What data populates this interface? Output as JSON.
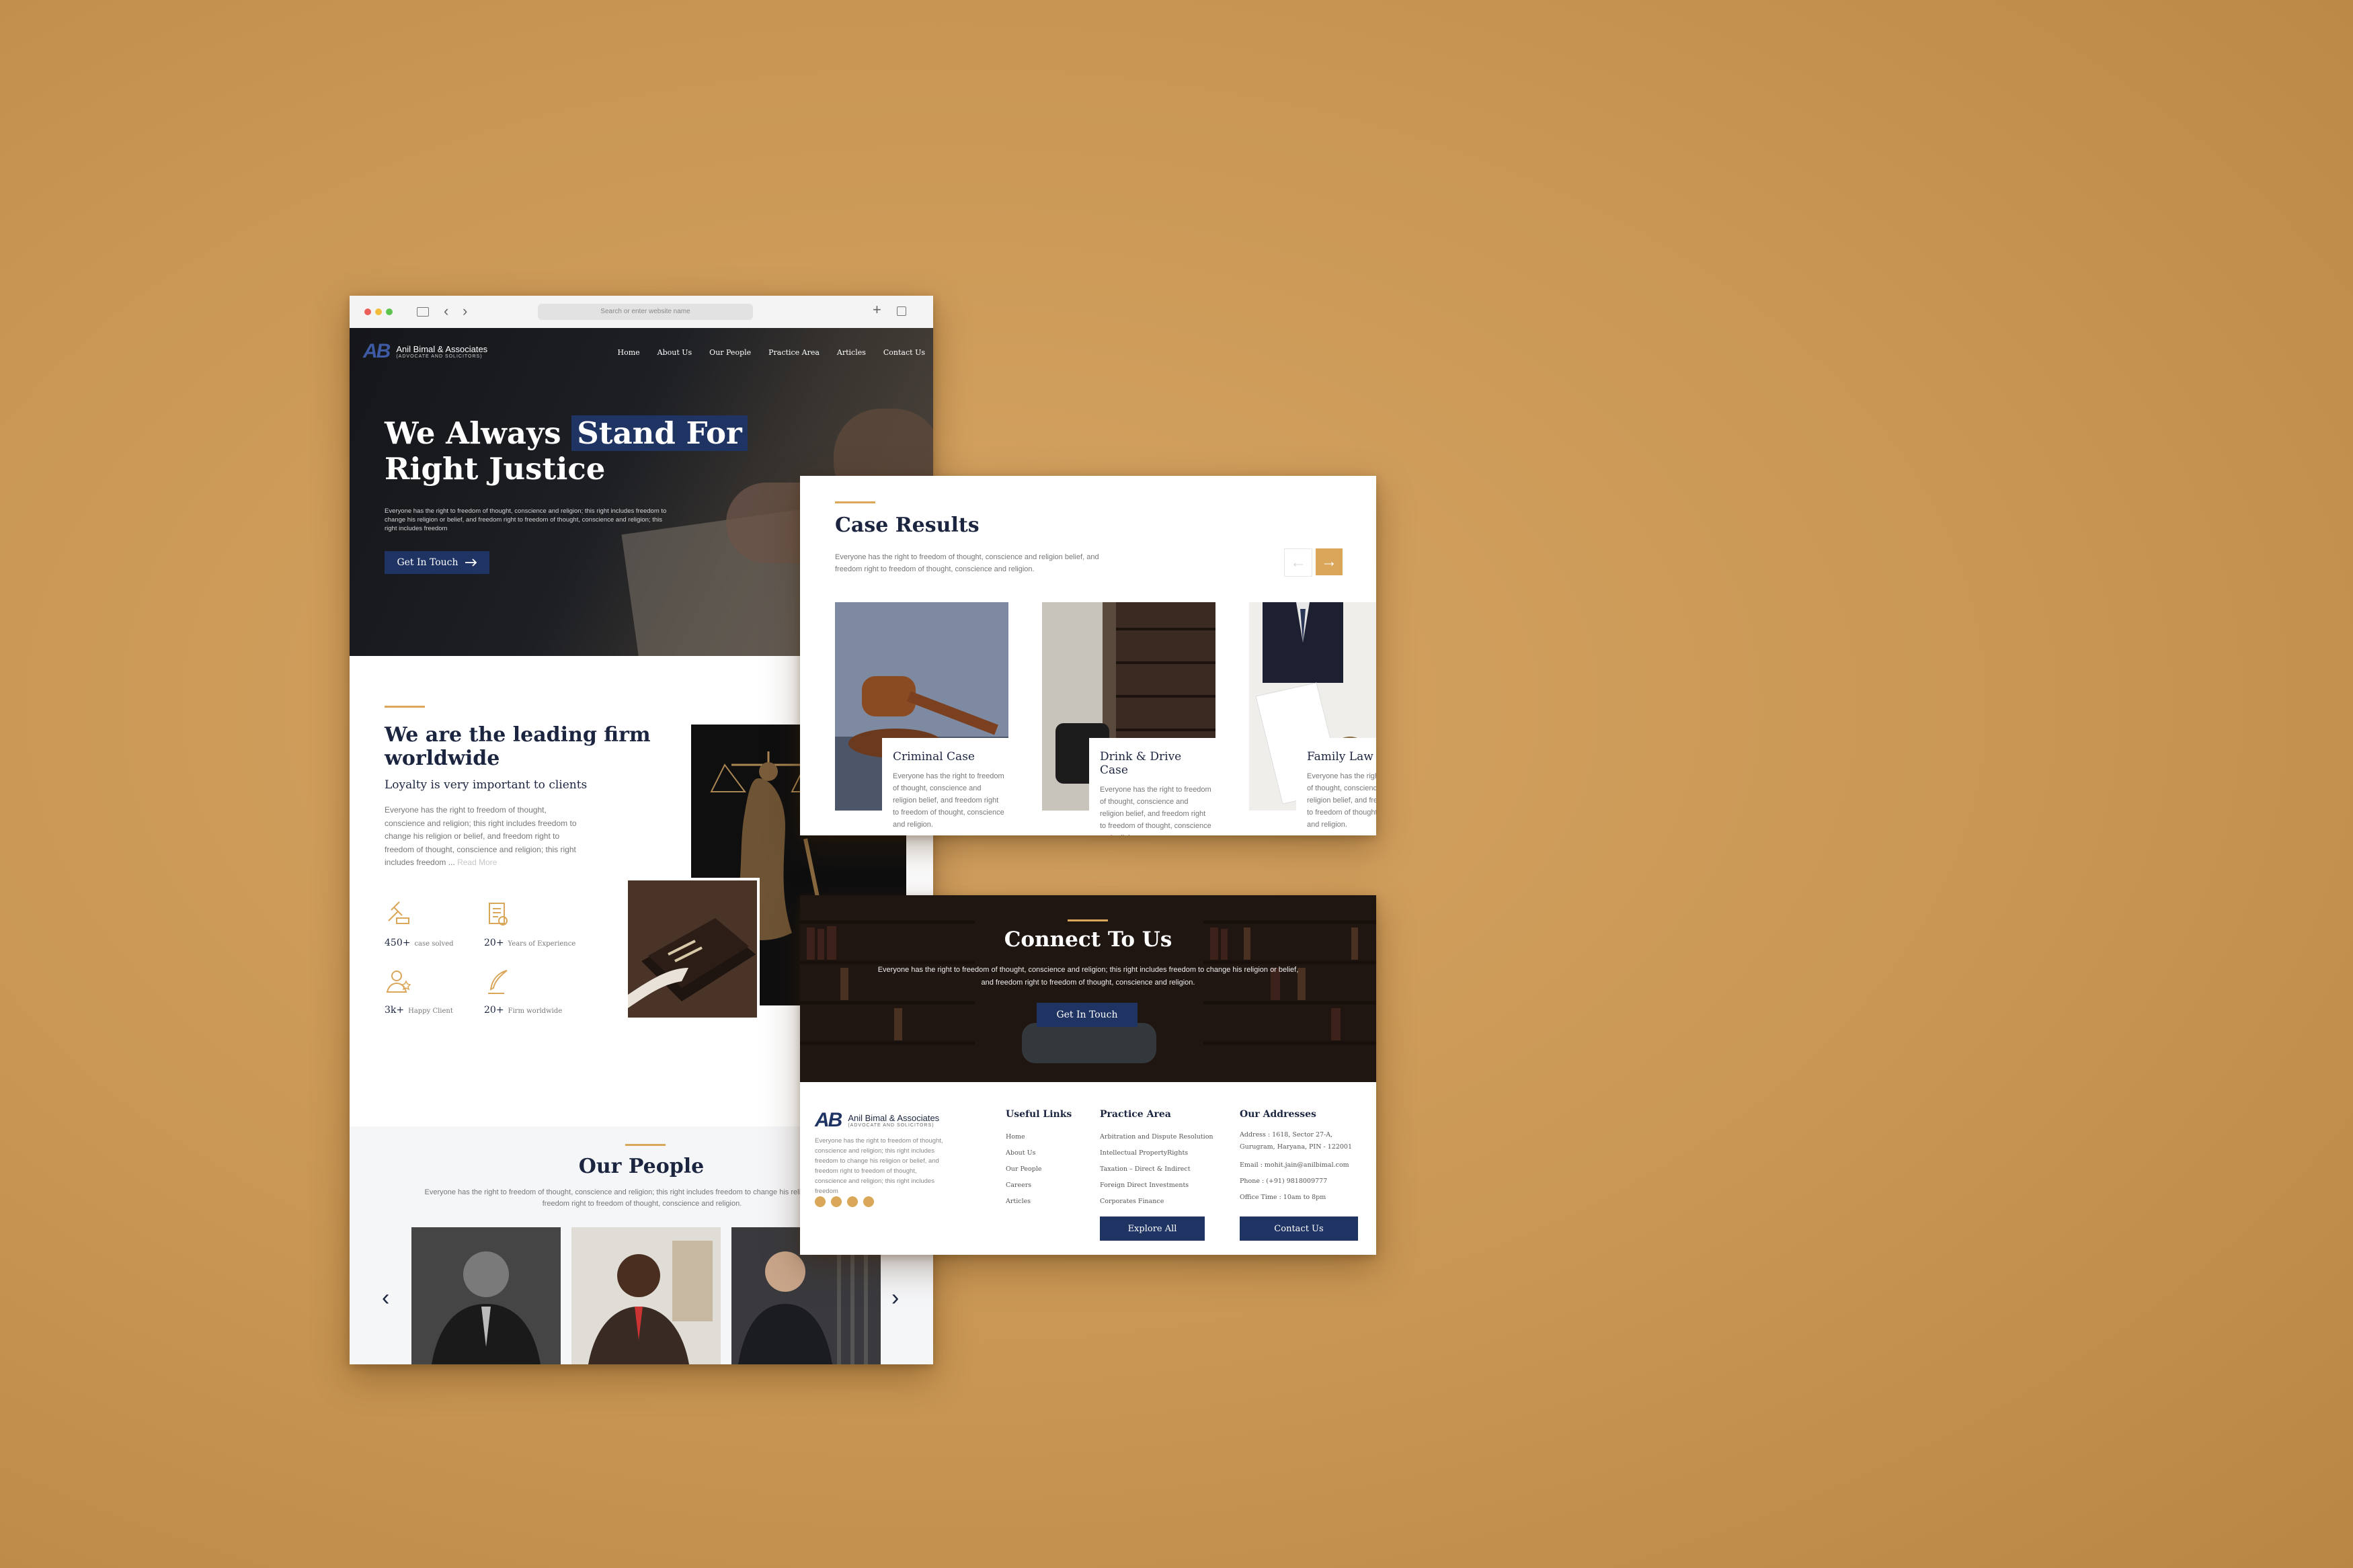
{
  "browser": {
    "url_placeholder": "Search or enter website name",
    "add_tab": "+",
    "back": "‹",
    "forward": "›"
  },
  "brand": {
    "mark": "AB",
    "name": "Anil Bimal & Associates",
    "subtitle": "(ADVOCATE AND SOLICITORS)"
  },
  "nav": [
    "Home",
    "About Us",
    "Our People",
    "Practice Area",
    "Articles",
    "Contact Us"
  ],
  "hero": {
    "title_part1": "We Always ",
    "title_highlight": "Stand For",
    "title_line2": "Right Justice",
    "description": "Everyone has the right to freedom of thought, conscience and religion; this right includes freedom to change his religion or belief, and freedom right to freedom of thought, conscience and religion; this right includes freedom",
    "cta_label": "Get In Touch"
  },
  "about": {
    "title": "We are the leading firm worldwide",
    "tagline": "Loyalty is very important to clients",
    "body": "Everyone has the right to freedom of thought, conscience and religion; this right includes freedom to change his religion or belief, and freedom right to freedom of thought, conscience and religion; this right includes freedom ...",
    "read_more": "Read More",
    "stats": [
      {
        "icon": "gavel-icon",
        "value": "450+",
        "label": "case solved"
      },
      {
        "icon": "certificate-icon",
        "value": "20+",
        "label": "Years of Experience"
      },
      {
        "icon": "happy-client-icon",
        "value": "3k+",
        "label": "Happy Client"
      },
      {
        "icon": "quill-icon",
        "value": "20+",
        "label": "Firm worldwide"
      }
    ]
  },
  "people": {
    "title": "Our People",
    "description": "Everyone has the right to freedom of thought, conscience and religion; this right includes freedom to change his religion or belief, and freedom right to freedom of thought, conscience and religion."
  },
  "cases": {
    "title": "Case Results",
    "description": "Everyone has the right to freedom of thought, conscience and religion belief, and freedom right to freedom of thought, conscience and religion.",
    "prev": "←",
    "next": "→",
    "items": [
      {
        "title": "Criminal Case",
        "text": "Everyone has the right to freedom of thought, conscience and religion belief, and freedom right to freedom of thought, conscience and religion."
      },
      {
        "title": "Drink & Drive Case",
        "text": "Everyone has the right to freedom of thought, conscience and religion belief, and freedom right to freedom of thought, conscience and religion."
      },
      {
        "title": "Family Law Case",
        "text": "Everyone has the right to freedom of thought, conscience and religion belief, and freedom right to freedom of thought, conscience and religion."
      }
    ]
  },
  "connect": {
    "title": "Connect To Us",
    "description": "Everyone has the right to freedom of thought, conscience and religion; this right includes freedom to change his religion or belief, and freedom right to freedom of thought, conscience and religion.",
    "cta_label": "Get In Touch"
  },
  "footer": {
    "blurb": "Everyone has the right to freedom of thought, conscience and religion; this right includes freedom to change his religion or belief, and freedom right to freedom of thought, conscience and religion; this right includes freedom",
    "useful_links_title": "Useful Links",
    "useful_links": [
      "Home",
      "About Us",
      "Our People",
      "Careers",
      "Articles"
    ],
    "practice_title": "Practice Area",
    "practice_links": [
      "Arbitration and Dispute Resolution",
      "Intellectual PropertyRights",
      "Taxation – Direct & Indirect",
      "Foreign Direct Investments",
      "Corporates Finance"
    ],
    "addresses_title": "Our Addresses",
    "address": "Address : 1618, Sector 27-A, Gurugram, Haryana, PIN - 122001",
    "email": "Email : mohit.jain@anilbimal.com",
    "phone": "Phone : (+91) 9818009777",
    "hours": "Office Time : 10am to 8pm",
    "explore_label": "Explore All",
    "contact_label": "Contact Us"
  },
  "colors": {
    "navy": "#1f3463",
    "gold": "#d9a65a",
    "background": "#c99653"
  }
}
